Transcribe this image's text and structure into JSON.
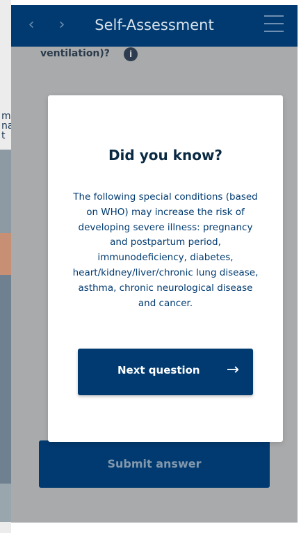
{
  "background": {
    "fragment_text": "m\nna\nt"
  },
  "header": {
    "title": "Self-Assessment",
    "back_icon": "chevron-left-icon",
    "forward_icon": "chevron-right-icon",
    "menu_icon": "hamburger-menu-icon"
  },
  "question": {
    "text_fragment": "ventilation)?",
    "info_icon": "i"
  },
  "modal": {
    "title": "Did you know?",
    "body": "The following special conditions (based on WHO) may increase the risk of developing severe illness: pregnancy and postpartum period, immunodeficiency, diabetes, heart/kidney/liver/chronic lung disease, asthma, chronic neurological disease and cancer.",
    "next_button_label": "Next question",
    "next_arrow": "→"
  },
  "footer": {
    "submit_label": "Submit answer"
  },
  "colors": {
    "brand_navy": "#003a70",
    "overlay": "#a8aaac",
    "modal_bg": "#ffffff"
  }
}
